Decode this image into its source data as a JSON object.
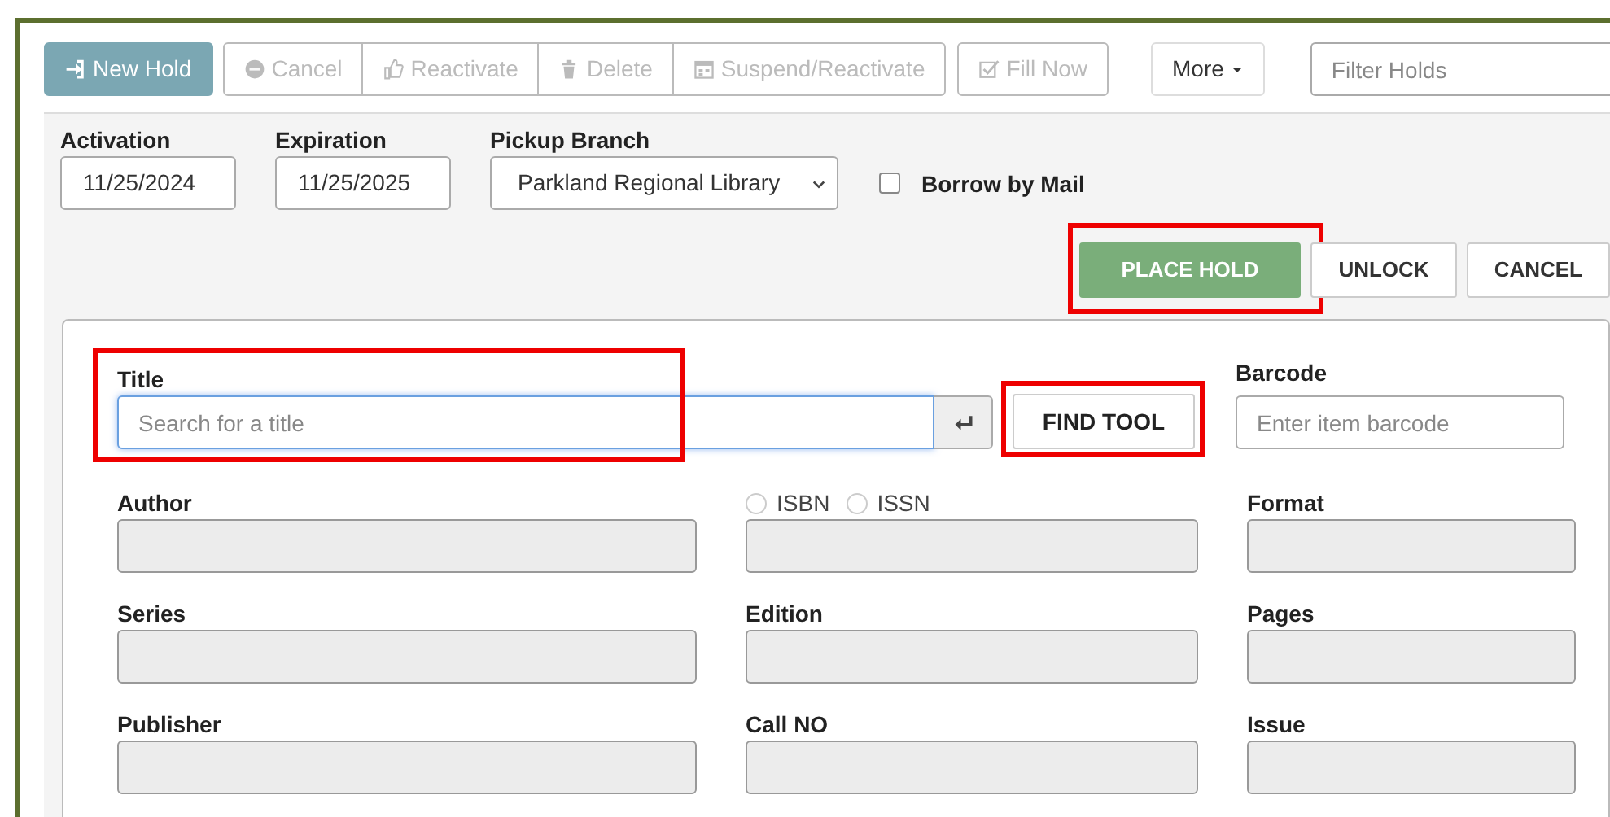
{
  "toolbar": {
    "buttons": [
      {
        "label": "New Hold",
        "kind": "primary",
        "disabled": false
      },
      {
        "label": "Cancel",
        "kind": "grouped",
        "disabled": true
      },
      {
        "label": "Reactivate",
        "kind": "grouped",
        "disabled": true
      },
      {
        "label": "Delete",
        "kind": "grouped",
        "disabled": true
      },
      {
        "label": "Suspend/Reactivate",
        "kind": "grouped",
        "disabled": true
      },
      {
        "label": "Fill Now",
        "kind": "single",
        "disabled": true
      }
    ],
    "more": {
      "label": "More"
    },
    "filter": {
      "placeholder": "Filter Holds"
    }
  },
  "hold_options": {
    "activation": {
      "label": "Activation",
      "value": "11/25/2024"
    },
    "expiration": {
      "label": "Expiration",
      "value": "11/25/2025"
    },
    "pickup_branch": {
      "label": "Pickup Branch",
      "value": "Parkland Regional Library"
    },
    "borrow_by_mail": {
      "label": "Borrow by Mail",
      "checked": false
    }
  },
  "actions": [
    {
      "label": "PLACE HOLD",
      "kind": "success",
      "highlighted": true
    },
    {
      "label": "UNLOCK",
      "kind": "default",
      "highlighted": false
    },
    {
      "label": "CANCEL",
      "kind": "default",
      "highlighted": false
    }
  ],
  "item": {
    "title": {
      "label": "Title",
      "placeholder": "Search for a title",
      "highlighted": true
    },
    "find_tool": {
      "label": "FIND TOOL",
      "highlighted": true
    },
    "barcode": {
      "label": "Barcode",
      "placeholder": "Enter item barcode"
    },
    "fields": [
      {
        "kind": "text",
        "label": "Author"
      },
      {
        "kind": "radio",
        "options": [
          {
            "label": "ISBN",
            "selected": false
          },
          {
            "label": "ISSN",
            "selected": false
          }
        ]
      },
      {
        "kind": "text",
        "label": "Format"
      },
      {
        "kind": "text",
        "label": "Series"
      },
      {
        "kind": "text",
        "label": "Edition"
      },
      {
        "kind": "text",
        "label": "Pages"
      },
      {
        "kind": "text",
        "label": "Publisher"
      },
      {
        "kind": "text",
        "label": "Call NO"
      },
      {
        "kind": "text",
        "label": "Issue"
      }
    ]
  }
}
